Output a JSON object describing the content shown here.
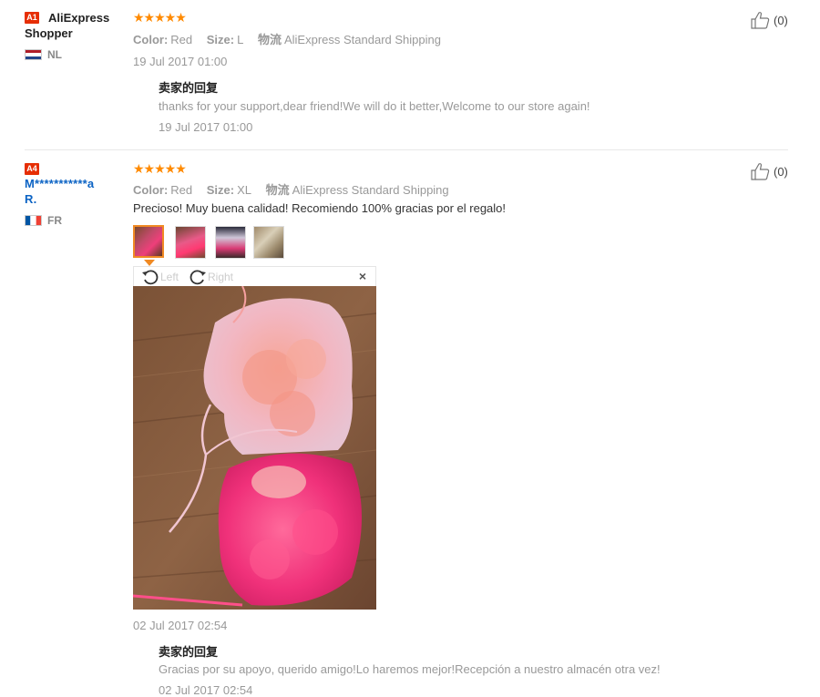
{
  "reviews": [
    {
      "badge": "A1",
      "user": "AliExpress Shopper",
      "country": "NL",
      "rating": 5,
      "color_label": "Color:",
      "color_value": "Red",
      "size_label": "Size:",
      "size_value": "L",
      "logistics_label": "物流",
      "logistics_value": "AliExpress Standard Shipping",
      "date": "19 Jul 2017 01:00",
      "reply_title": "卖家的回复",
      "reply_text": "thanks for your support,dear friend!We will do it better,Welcome to our store again!",
      "reply_date": "19 Jul 2017 01:00",
      "helpful_count": "(0)"
    },
    {
      "badge": "A4",
      "user_line1": "M***********a",
      "user_line2": "R.",
      "country": "FR",
      "rating": 5,
      "color_label": "Color:",
      "color_value": "Red",
      "size_label": "Size:",
      "size_value": "XL",
      "logistics_label": "物流",
      "logistics_value": "AliExpress Standard Shipping",
      "comment": "Precioso! Muy buena calidad! Recomiendo 100% gracias por el regalo!",
      "viewer": {
        "left_label": "Left",
        "right_label": "Right",
        "close": "×"
      },
      "date": "02 Jul 2017 02:54",
      "reply_title": "卖家的回复",
      "reply_text": "Gracias por su apoyo, querido amigo!Lo haremos mejor!Recepción a nuestro almacén otra vez!",
      "reply_date": "02 Jul 2017 02:54",
      "helpful_count": "(0)"
    }
  ],
  "stars_glyph": "★★★★★",
  "colors": {
    "accent": "#ff8a00",
    "badge": "#e62e04",
    "user_link": "#0b63c4"
  }
}
